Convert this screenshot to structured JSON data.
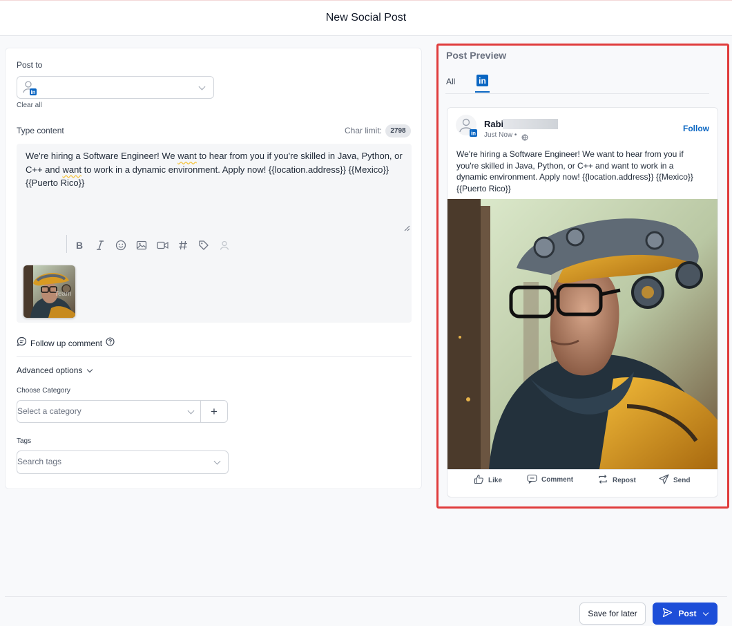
{
  "header": {
    "title": "New Social Post"
  },
  "compose": {
    "post_to_label": "Post to",
    "clear_all": "Clear all",
    "type_content_label": "Type content",
    "char_limit_label": "Char limit:",
    "char_limit_value": "2798",
    "content_part1": "We're hiring a Software Engineer! We ",
    "content_want1": "want",
    "content_part2": " to hear from you if you're skilled in Java, Python, or C++ and ",
    "content_want2": "want",
    "content_part3": " to work in a dynamic environment. Apply now! {{location.address}} {{Mexico}} {{Puerto Rico}}",
    "attachment_watermark": "Team",
    "follow_up_label": "Follow up comment",
    "advanced_options_label": "Advanced options",
    "category_label": "Choose Category",
    "category_placeholder": "Select a category",
    "tags_label": "Tags",
    "tags_placeholder": "Search tags",
    "add_symbol": "+"
  },
  "preview": {
    "title": "Post Preview",
    "tab_all": "All",
    "tab_linkedin": "in",
    "author_name": "Rabi",
    "timestamp": "Just Now •",
    "follow": "Follow",
    "text": "We're hiring a Software Engineer! We want to hear from you if you're skilled in Java, Python, or C++ and want to work in a dynamic environment. Apply now! {{location.address}} {{Mexico}} {{Puerto Rico}}",
    "actions": {
      "like": "Like",
      "comment": "Comment",
      "repost": "Repost",
      "send": "Send"
    }
  },
  "footer": {
    "save_label": "Save for later",
    "post_label": "Post"
  },
  "colors": {
    "accent": "#1d4ed8",
    "linkedin": "#0a66c2",
    "highlight": "#e03c3c"
  }
}
